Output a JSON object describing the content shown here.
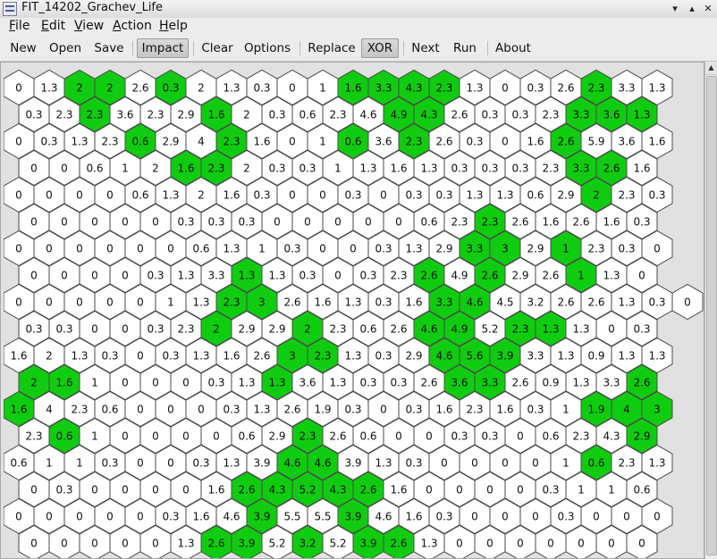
{
  "window": {
    "title": "FIT_14202_Grachev_Life",
    "buttons": {
      "minimize": "▾",
      "maximize": "▴",
      "close": "✕"
    }
  },
  "menubar": {
    "items": [
      "File",
      "Edit",
      "View",
      "Action",
      "Help"
    ]
  },
  "toolbar": {
    "new": "New",
    "open": "Open",
    "save": "Save",
    "impact": "Impact",
    "clear": "Clear",
    "options": "Options",
    "replace": "Replace",
    "xor": "XOR",
    "next": "Next",
    "run": "Run",
    "about": "About"
  },
  "scrollbar": {
    "up_arrow": "▲"
  },
  "field": {
    "alive_color": "#10cc10",
    "dead_color": "#ffffff",
    "rows": [
      {
        "impact": [
          "0",
          "1.3",
          "2",
          "2",
          "2.6",
          "0.3",
          "2",
          "1.3",
          "0.3",
          "0",
          "1",
          "1.6",
          "3.3",
          "4.3",
          "2.3",
          "1.3",
          "0",
          "0.3",
          "2.6",
          "2.3",
          "3.3",
          "1.3"
        ],
        "alive": [
          2,
          3,
          5,
          11,
          12,
          13,
          14,
          19
        ]
      },
      {
        "impact": [
          "0.3",
          "2.3",
          "2.3",
          "3.6",
          "2.3",
          "2.9",
          "1.6",
          "2",
          "0.3",
          "0.6",
          "2.3",
          "4.6",
          "4.9",
          "4.3",
          "2.6",
          "0.3",
          "0.3",
          "2.3",
          "3.3",
          "3.6",
          "1.3"
        ],
        "alive": [
          2,
          6,
          12,
          13,
          18,
          19,
          20
        ]
      },
      {
        "impact": [
          "0",
          "0.3",
          "1.3",
          "2.3",
          "0.6",
          "2.9",
          "4",
          "2.3",
          "1.6",
          "0",
          "1",
          "0.6",
          "3.6",
          "2.3",
          "2.6",
          "0.3",
          "0",
          "1.6",
          "2.6",
          "5.9",
          "3.6",
          "1.6"
        ],
        "alive": [
          4,
          7,
          11,
          13,
          18
        ]
      },
      {
        "impact": [
          "0",
          "0",
          "0.6",
          "1",
          "2",
          "1.6",
          "2.3",
          "2",
          "0.3",
          "0.3",
          "1",
          "1.3",
          "1.6",
          "1.3",
          "0.3",
          "0.3",
          "0.3",
          "2.3",
          "3.3",
          "2.6",
          "1.6"
        ],
        "alive": [
          5,
          6,
          18,
          19
        ]
      },
      {
        "impact": [
          "0",
          "0",
          "0",
          "0",
          "0.6",
          "1.3",
          "2",
          "1.6",
          "0.3",
          "0",
          "0",
          "0.3",
          "0",
          "0.3",
          "0.3",
          "1.3",
          "1.3",
          "0.6",
          "2.9",
          "2",
          "2.3",
          "0.3"
        ],
        "alive": [
          19
        ]
      },
      {
        "impact": [
          "0",
          "0",
          "0",
          "0",
          "0",
          "0.3",
          "0.3",
          "0.3",
          "0",
          "0",
          "0",
          "0",
          "0",
          "0.6",
          "2.3",
          "2.3",
          "2.6",
          "1.6",
          "2.6",
          "1.6",
          "0.3"
        ],
        "alive": [
          15
        ]
      },
      {
        "impact": [
          "0",
          "0",
          "0",
          "0",
          "0",
          "0",
          "0.6",
          "1.3",
          "1",
          "0.3",
          "0",
          "0",
          "0.3",
          "1.3",
          "2.9",
          "3.3",
          "3",
          "2.9",
          "1",
          "2.3",
          "0.3",
          "0"
        ],
        "alive": [
          15,
          16,
          18
        ]
      },
      {
        "impact": [
          "0",
          "0",
          "0",
          "0",
          "0.3",
          "1.3",
          "3.3",
          "1.3",
          "1.3",
          "0.3",
          "0",
          "0.3",
          "2.3",
          "2.6",
          "4.9",
          "2.6",
          "2.9",
          "2.6",
          "1",
          "1.3",
          "0"
        ],
        "alive": [
          7,
          13,
          15,
          18
        ]
      },
      {
        "impact": [
          "0",
          "0",
          "0",
          "0",
          "0",
          "1",
          "1.3",
          "2.3",
          "3",
          "2.6",
          "1.6",
          "1.3",
          "0.3",
          "1.6",
          "3.3",
          "4.6",
          "4.5",
          "3.2",
          "2.6",
          "2.6",
          "1.3",
          "0.3",
          "0"
        ],
        "alive": [
          7,
          8,
          14,
          15
        ]
      },
      {
        "impact": [
          "0.3",
          "0.3",
          "0",
          "0",
          "0.3",
          "2.3",
          "2",
          "2.9",
          "2.9",
          "2",
          "2.3",
          "0.6",
          "2.6",
          "4.6",
          "4.9",
          "5.2",
          "2.3",
          "1.3",
          "1.3",
          "0",
          "0.3"
        ],
        "alive": [
          6,
          9,
          13,
          14,
          16,
          17
        ]
      },
      {
        "impact": [
          "1.6",
          "2",
          "1.3",
          "0.3",
          "0",
          "0.3",
          "1.3",
          "1.6",
          "2.6",
          "3",
          "2.3",
          "1.3",
          "0.3",
          "2.9",
          "4.6",
          "5.6",
          "3.9",
          "3.3",
          "1.3",
          "0.9",
          "1.3",
          "1.3"
        ],
        "alive": [
          9,
          10,
          14,
          15,
          16
        ]
      },
      {
        "impact": [
          "2",
          "1.6",
          "1",
          "0",
          "0",
          "0",
          "0.3",
          "1.3",
          "1.3",
          "3.6",
          "1.3",
          "0.3",
          "0.3",
          "2.6",
          "3.6",
          "3.3",
          "2.6",
          "0.9",
          "1.3",
          "3.3",
          "2.6"
        ],
        "alive": [
          0,
          1,
          8,
          14,
          15,
          20
        ]
      },
      {
        "impact": [
          "1.6",
          "4",
          "2.3",
          "0.6",
          "0",
          "0",
          "0",
          "0.3",
          "1.3",
          "2.6",
          "1.9",
          "0.3",
          "0",
          "0.3",
          "1.6",
          "2.3",
          "1.6",
          "0.3",
          "1",
          "1.9",
          "4",
          "3"
        ],
        "alive": [
          0,
          19,
          20,
          21
        ]
      },
      {
        "impact": [
          "2.3",
          "0.6",
          "1",
          "0",
          "0",
          "0",
          "0",
          "0.6",
          "2.9",
          "2.3",
          "2.6",
          "0.6",
          "0",
          "0",
          "0.3",
          "0.3",
          "0",
          "0.6",
          "2.3",
          "4.3",
          "2.9"
        ],
        "alive": [
          1,
          9,
          20
        ]
      },
      {
        "impact": [
          "0.6",
          "1",
          "1",
          "0.3",
          "0",
          "0",
          "0.3",
          "1.3",
          "3.9",
          "4.6",
          "4.6",
          "3.9",
          "1.3",
          "0.3",
          "0",
          "0",
          "0",
          "0",
          "1",
          "0.6",
          "2.3",
          "1.3"
        ],
        "alive": [
          9,
          10,
          19
        ]
      },
      {
        "impact": [
          "0",
          "0.3",
          "0",
          "0",
          "0",
          "0",
          "1.6",
          "2.6",
          "4.3",
          "5.2",
          "4.3",
          "2.6",
          "1.6",
          "0",
          "0",
          "0",
          "0",
          "0.3",
          "1",
          "1",
          "0.6"
        ],
        "alive": [
          7,
          8,
          9,
          10,
          11
        ]
      },
      {
        "impact": [
          "0",
          "0",
          "0",
          "0",
          "0",
          "0.3",
          "1.6",
          "4.6",
          "3.9",
          "5.5",
          "5.5",
          "3.9",
          "4.6",
          "1.6",
          "0.3",
          "0",
          "0",
          "0",
          "0.3",
          "0",
          "0",
          "0"
        ],
        "alive": [
          8,
          11
        ]
      },
      {
        "impact": [
          "0",
          "0",
          "0",
          "0",
          "0",
          "1.3",
          "2.6",
          "3.9",
          "5.2",
          "3.2",
          "5.2",
          "3.9",
          "2.6",
          "1.3",
          "0",
          "0",
          "0",
          "0",
          "0",
          "0",
          "0"
        ],
        "alive": [
          6,
          7,
          9,
          11,
          12
        ]
      }
    ]
  }
}
